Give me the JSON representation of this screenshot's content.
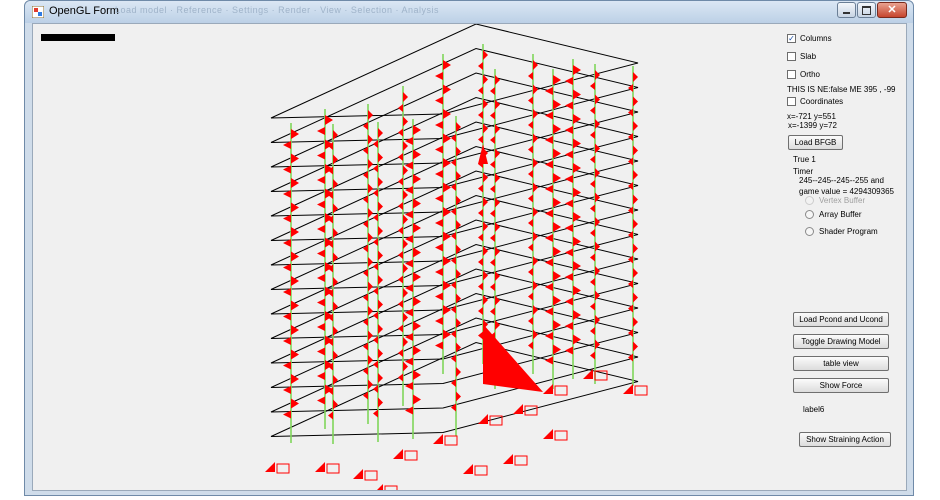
{
  "window": {
    "title": "OpenGL Form",
    "ghost_menu": "Load model · Reference · Settings · Render · View · Selection · Analysis"
  },
  "canvas": {
    "description_icon": "3d-building-frame"
  },
  "panel": {
    "columns_label": "Columns",
    "columns_checked": true,
    "slab_label": "Slab",
    "ortho_label": "Ortho",
    "status_line": "THIS IS NE:false  ME  395 , -99",
    "coordinates_label": "Coordinates",
    "coord_line1": "x=-721 y=551",
    "coord_line2": "x=-1399 y=72",
    "load_bfgb": "Load BFGB",
    "true_line": "True 1",
    "timer_label": "Timer",
    "color_line": "245--245--245--255 and",
    "game_value": "game value = 4294309365",
    "radio_vertex": "Vertex Buffer",
    "radio_array": "Array Buffer",
    "radio_shader": "Shader Program",
    "btn_load_pcond": "Load Pcond and Ucond",
    "btn_toggle": "Toggle Drawing Model",
    "btn_table": "table view",
    "btn_show_force": "Show Force",
    "label6": "label6",
    "btn_straining": "Show Straining Action"
  },
  "colors": {
    "frame": "#000000",
    "column": "#7fd65a",
    "force": "#ff0000",
    "background": "#f0f0f0"
  }
}
